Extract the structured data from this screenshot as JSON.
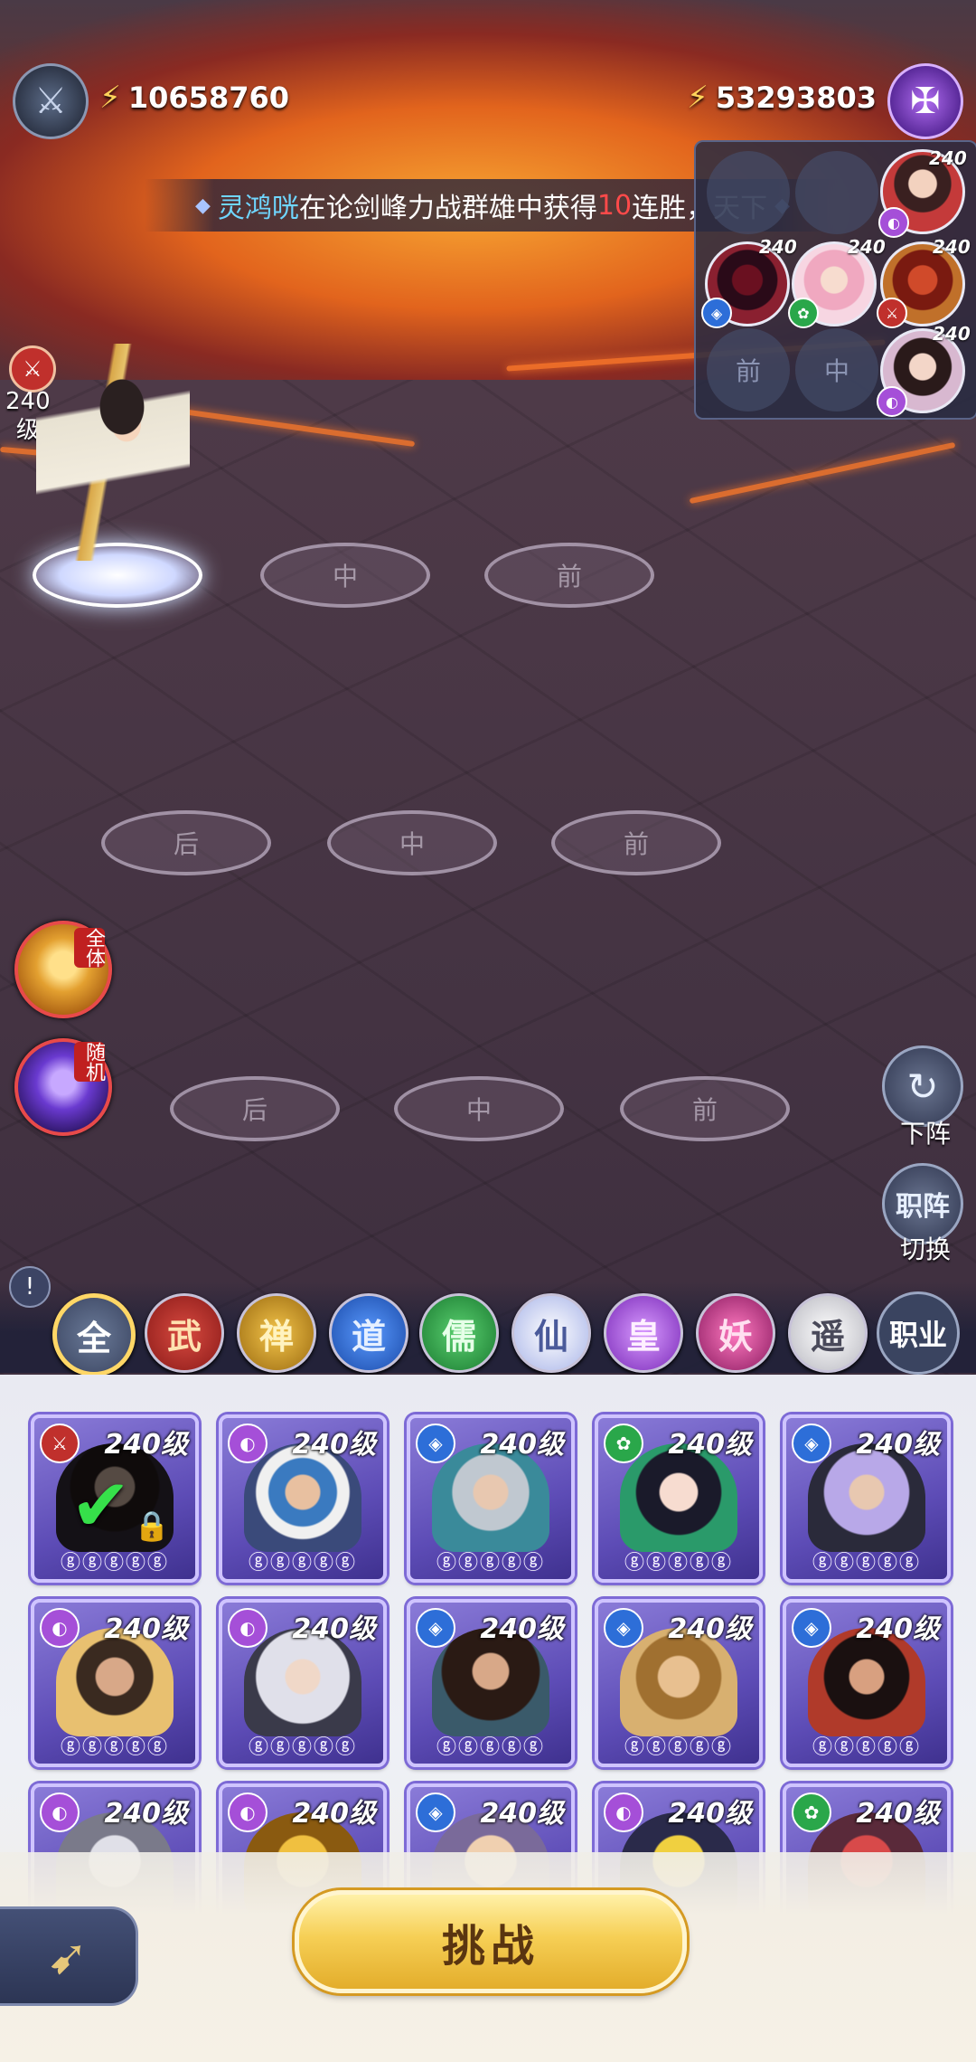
{
  "top": {
    "left_power": "10658760",
    "right_power": "53293803"
  },
  "broadcast": {
    "name": "灵鸿咣",
    "text1": "在论剑峰力战群雄中获得",
    "num": "10",
    "text2": "连胜，天下"
  },
  "enemy": {
    "empty_slot_front": "前",
    "empty_slot_mid": "中",
    "levels": [
      "240",
      "240",
      "240",
      "240",
      "240"
    ]
  },
  "player": {
    "level_num": "240",
    "level_unit": "级"
  },
  "formation": {
    "back": "后",
    "mid": "中",
    "front": "前"
  },
  "skills": {
    "all_tag": "全体",
    "random_tag": "随机"
  },
  "side": {
    "unequip_label": "下阵",
    "switch_icon": "职阵",
    "switch_label": "切换"
  },
  "filters": [
    "全",
    "武",
    "禅",
    "道",
    "儒",
    "仙",
    "皇",
    "妖",
    "遥"
  ],
  "filter_job": "职业",
  "roster": {
    "level_text": "240级",
    "stars": "ⓖⓖⓖⓖⓖ"
  },
  "challenge_label": "挑战",
  "colors": {
    "wu": "#c0302c",
    "chan": "#b98a1c",
    "dao": "#2d6ed8",
    "ru": "#2aa74a",
    "xian": "#c9d3f5",
    "huang": "#a54fd8",
    "yao": "#c83a8e",
    "yao2": "#e6e6ea",
    "accent_gold": "#ffd766"
  }
}
